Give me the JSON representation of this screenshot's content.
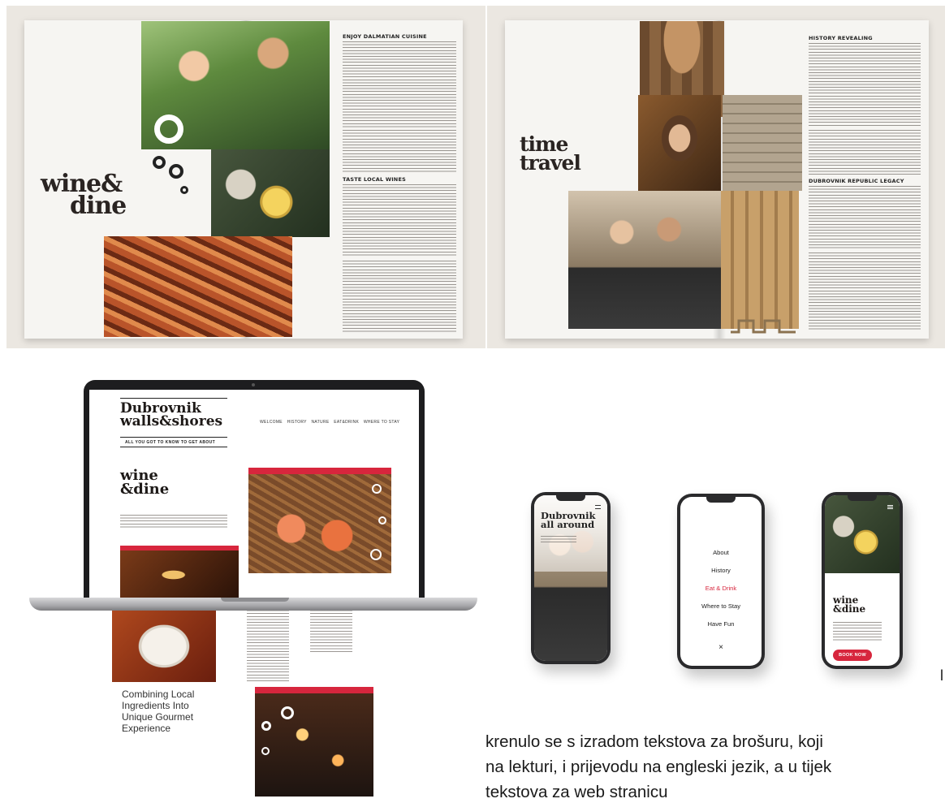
{
  "magazine_left": {
    "title_line1": "wine&",
    "title_line2": "dine",
    "section1_heading": "ENJOY DALMATIAN CUISINE",
    "section2_heading": "TASTE LOCAL WINES"
  },
  "magazine_right": {
    "title_line1": "time",
    "title_line2": "travel",
    "section1_heading": "HISTORY REVEALING",
    "section2_heading": "DUBROVNIK REPUBLIC LEGACY"
  },
  "laptop_site": {
    "logo_line1": "Dubrovnik",
    "logo_line2": "walls&shores",
    "tagline": "ALL YOU GOT TO KNOW TO GET ABOUT",
    "nav": [
      "WELCOME",
      "HISTORY",
      "NATURE",
      "EAT&DRINK",
      "WHERE TO STAY"
    ],
    "hero_line1": "wine",
    "hero_line2": "&dine",
    "lower_text_line1": "Combining Local",
    "lower_text_line2": "Ingredients Into",
    "lower_text_line3": "Unique Gourmet",
    "lower_text_line4": "Experience"
  },
  "phone1": {
    "title_line1": "Dubrovnik",
    "title_line2": "all around"
  },
  "phone2": {
    "menu": [
      "About",
      "History",
      "Eat & Drink",
      "Where to Stay",
      "Have Fun"
    ],
    "active_item": "Eat & Drink",
    "close_symbol": "×"
  },
  "phone3": {
    "title_line1": "wine",
    "title_line2": "&dine",
    "button_label": "BOOK NOW"
  },
  "paragraph": {
    "line1": "krenulo se s izradom tekstova za brošuru, koji",
    "line2": "na lekturi, i prijevodu na engleski jezik, a u tijek",
    "line3": "tekstova za web stranicu"
  },
  "accent_color": "#d7263d"
}
